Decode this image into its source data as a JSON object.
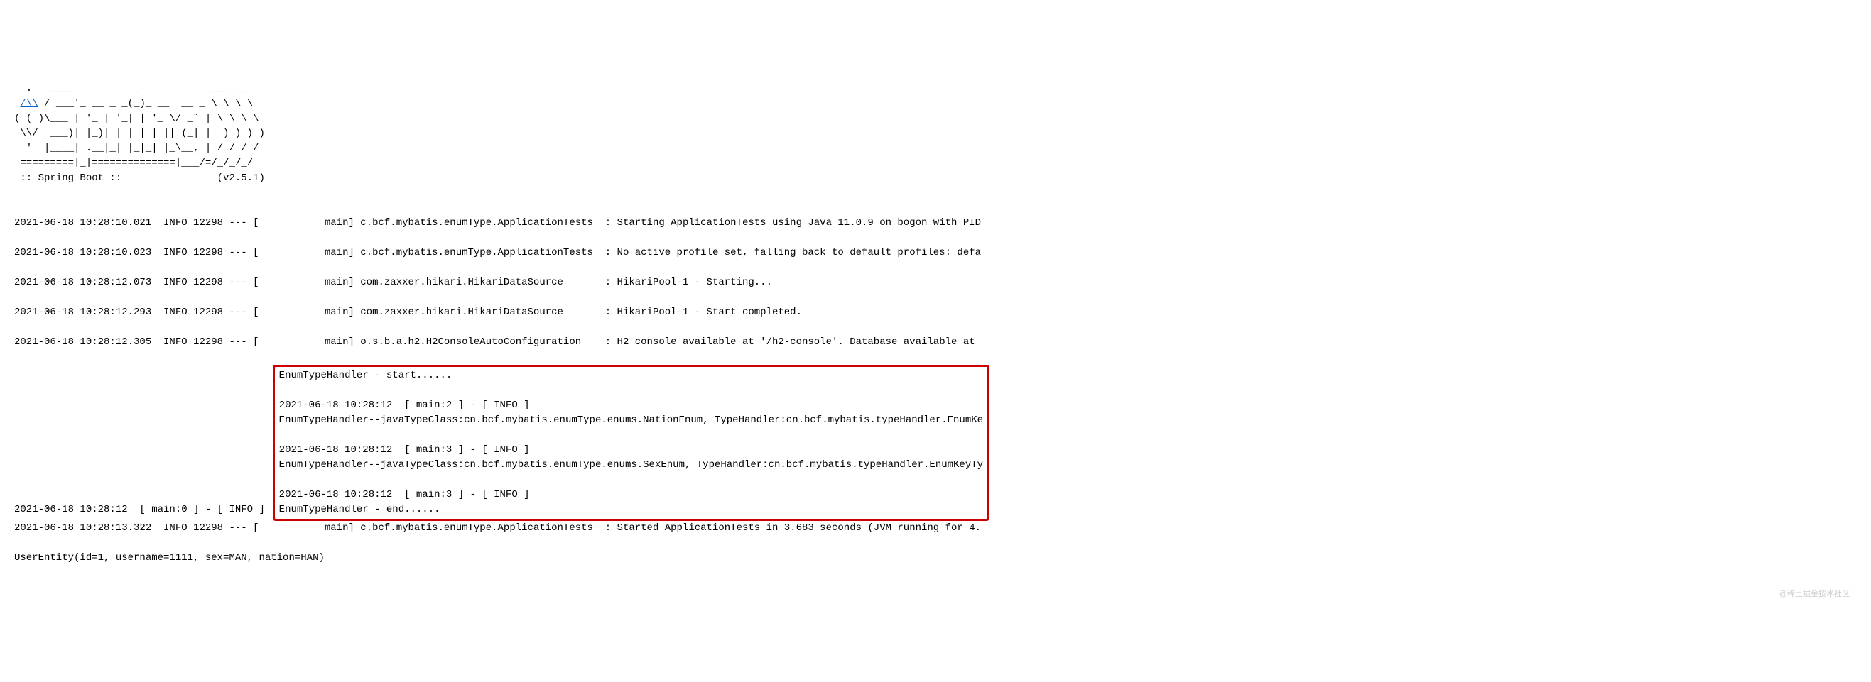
{
  "banner": {
    "l1": "  .   ____          _            __ _ _",
    "l2_prefix": " ",
    "l2_link": "/\\\\",
    "l2_suffix": " / ___'_ __ _ _(_)_ __  __ _ \\ \\ \\ \\",
    "l3": "( ( )\\___ | '_ | '_| | '_ \\/ _` | \\ \\ \\ \\",
    "l4": " \\\\/  ___)| |_)| | | | | || (_| |  ) ) ) )",
    "l5": "  '  |____| .__|_| |_|_| |_\\__, | / / / /",
    "l6": " =========|_|==============|___/=/_/_/_/",
    "l7": " :: Spring Boot ::                (v2.5.1)"
  },
  "logs": {
    "r1": "2021-06-18 10:28:10.021  INFO 12298 --- [           main] c.bcf.mybatis.enumType.ApplicationTests  : Starting ApplicationTests using Java 11.0.9 on bogon with PID",
    "r2": "2021-06-18 10:28:10.023  INFO 12298 --- [           main] c.bcf.mybatis.enumType.ApplicationTests  : No active profile set, falling back to default profiles: defa",
    "r3": "2021-06-18 10:28:12.073  INFO 12298 --- [           main] com.zaxxer.hikari.HikariDataSource       : HikariPool-1 - Starting...",
    "r4": "2021-06-18 10:28:12.293  INFO 12298 --- [           main] com.zaxxer.hikari.HikariDataSource       : HikariPool-1 - Start completed.",
    "r5": "2021-06-18 10:28:12.305  INFO 12298 --- [           main] o.s.b.a.h2.H2ConsoleAutoConfiguration    : H2 console available at '/h2-console'. Database available at "
  },
  "highlighted": {
    "h1_prefix": "2021-06-18 10:28:12  [ main:0 ] - [ INFO ]  ",
    "h1_msg": "EnumTypeHandler - start......",
    "h2_prefix": "2021-06-18 10:28:12  [ main:2 ] - [ INFO ]  ",
    "h2_msg": "EnumTypeHandler--javaTypeClass:cn.bcf.mybatis.enumType.enums.NationEnum, TypeHandler:cn.bcf.mybatis.typeHandler.EnumKe",
    "h3_prefix": "2021-06-18 10:28:12  [ main:3 ] - [ INFO ]  ",
    "h3_msg": "EnumTypeHandler--javaTypeClass:cn.bcf.mybatis.enumType.enums.SexEnum, TypeHandler:cn.bcf.mybatis.typeHandler.EnumKeyTy",
    "h4_prefix": "2021-06-18 10:28:12  [ main:3 ] - [ INFO ]  ",
    "h4_msg": "EnumTypeHandler - end......"
  },
  "tail": {
    "t1": "2021-06-18 10:28:13.322  INFO 12298 --- [           main] c.bcf.mybatis.enumType.ApplicationTests  : Started ApplicationTests in 3.683 seconds (JVM running for 4.",
    "t2": "UserEntity(id=1, username=1111, sex=MAN, nation=HAN)"
  },
  "watermark": "@稀土掘金技术社区"
}
